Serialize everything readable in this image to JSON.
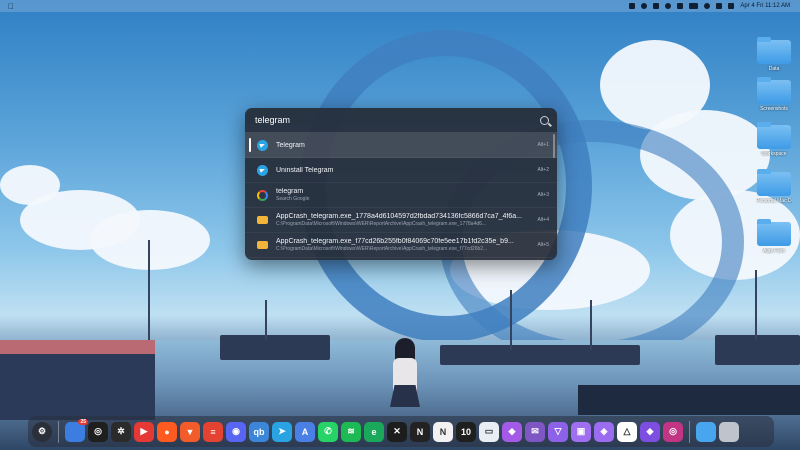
{
  "menubar": {
    "apple_icon": "apple-icon",
    "datetime": "Apr 4 Fri 11:12 AM"
  },
  "desktop": {
    "items": [
      {
        "label": "Data",
        "icon": "folder-icon"
      },
      {
        "label": "Screenshots",
        "icon": "folder-icon"
      },
      {
        "label": "Workspace",
        "icon": "folder-icon"
      },
      {
        "label": "Personal Mac Docs",
        "icon": "folder-icon"
      },
      {
        "label": "Ajay Files",
        "icon": "folder-icon"
      }
    ]
  },
  "spotlight": {
    "query": "telegram",
    "results": [
      {
        "title": "Telegram",
        "subtitle": "",
        "shortcut": "Alt+1",
        "icon": "telegram-icon",
        "selected": true
      },
      {
        "title": "Uninstall Telegram",
        "subtitle": "",
        "shortcut": "Alt+2",
        "icon": "telegram-icon",
        "selected": false
      },
      {
        "title": "telegram",
        "subtitle": "Search Google",
        "shortcut": "Alt+3",
        "icon": "google-icon",
        "selected": false
      },
      {
        "title": "AppCrash_telegram.exe_1778a4d6104597d2fbdad734136fc5866d7ca7_4f6a...",
        "subtitle": "C:\\ProgramData\\Microsoft\\Windows\\WER\\ReportArchive\\AppCrash_telegram.exe_1778a4d6...",
        "shortcut": "Alt+4",
        "icon": "folder-icon",
        "selected": false
      },
      {
        "title": "AppCrash_telegram.exe_f77cd26b255fb0f84069c70fe5ee17b1fd2c35e_b9...",
        "subtitle": "C:\\ProgramData\\Microsoft\\Windows\\WER\\ReportArchive\\AppCrash_telegram.exe_f77cd26b2...",
        "shortcut": "Alt+5",
        "icon": "folder-icon",
        "selected": false
      }
    ]
  },
  "dock": {
    "badge": "25",
    "apps": [
      {
        "name": "steam-icon",
        "glyph": "",
        "color": "#2b2f3a"
      },
      {
        "name": "chrome-icon",
        "glyph": "",
        "color": "#3b7de0"
      },
      {
        "name": "openai-icon",
        "glyph": "◎",
        "color": "#1f1f1f"
      },
      {
        "name": "chatgpt-icon",
        "glyph": "✲",
        "color": "#2b2b2b"
      },
      {
        "name": "youtube-icon",
        "glyph": "▶",
        "color": "#e53935"
      },
      {
        "name": "reddit-icon",
        "glyph": "●",
        "color": "#ff5a1f"
      },
      {
        "name": "brave-icon",
        "glyph": "▼",
        "color": "#f25c2a"
      },
      {
        "name": "todoist-icon",
        "glyph": "≡",
        "color": "#e44332"
      },
      {
        "name": "discord-icon",
        "glyph": "◉",
        "color": "#5865f2"
      },
      {
        "name": "qbittorrent-icon",
        "glyph": "qb",
        "color": "#3b86d6"
      },
      {
        "name": "telegram-icon",
        "glyph": "➤",
        "color": "#2aa3e3"
      },
      {
        "name": "arc-icon",
        "glyph": "A",
        "color": "#4a7fe5"
      },
      {
        "name": "whatsapp-icon",
        "glyph": "✆",
        "color": "#25d366"
      },
      {
        "name": "spotify-icon",
        "glyph": "≋",
        "color": "#1db954"
      },
      {
        "name": "edge-icon",
        "glyph": "e",
        "color": "#1aa85a"
      },
      {
        "name": "xbox-icon",
        "glyph": "✕",
        "color": "#1d1d1d"
      },
      {
        "name": "notion-icon",
        "glyph": "N",
        "color": "#222"
      },
      {
        "name": "notion-app-icon",
        "glyph": "N",
        "color": "#f2f2f2"
      },
      {
        "name": "kanban-icon",
        "glyph": "10",
        "color": "#1f1f1f"
      },
      {
        "name": "window-icon",
        "glyph": "▭",
        "color": "#e9eef5"
      },
      {
        "name": "linear-icon",
        "glyph": "◆",
        "color": "#a35ae6"
      },
      {
        "name": "email-icon",
        "glyph": "✉",
        "color": "#7e57c2"
      },
      {
        "name": "vpn-icon",
        "glyph": "▽",
        "color": "#8e62e8"
      },
      {
        "name": "files-icon",
        "glyph": "▣",
        "color": "#a06ef0"
      },
      {
        "name": "gem-icon",
        "glyph": "◈",
        "color": "#9b6cf0"
      },
      {
        "name": "google-drive-icon",
        "glyph": "△",
        "color": "#ffffff"
      },
      {
        "name": "proton-icon",
        "glyph": "◆",
        "color": "#7d4fe0"
      },
      {
        "name": "instagram-icon",
        "glyph": "◎",
        "color": "#c13584"
      }
    ],
    "trailing": [
      {
        "name": "downloads-folder-icon",
        "color": "#48a6ee"
      },
      {
        "name": "trash-icon",
        "color": "#bfc4cc"
      }
    ]
  }
}
